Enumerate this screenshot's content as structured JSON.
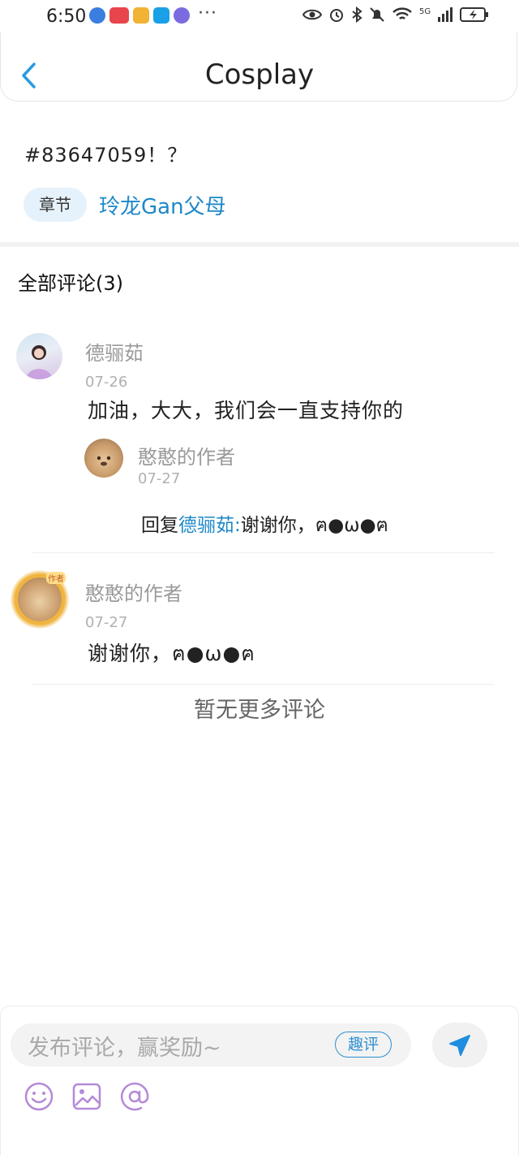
{
  "status_bar": {
    "time": "6:50",
    "more": "···",
    "network": "5G"
  },
  "header": {
    "title": "Cosplay"
  },
  "post": {
    "title": "#83647059！？",
    "chapter_label": "章节",
    "chapter_name": "玲龙Gan父母"
  },
  "comments_section": {
    "title": "全部评论(3)",
    "comments": [
      {
        "username": "德骊茹",
        "date": "07-26",
        "text": "加油，大大，我们会一直支持你的",
        "reply": {
          "username": "憨憨的作者",
          "date": "07-27",
          "prefix": "回复",
          "target": "德骊茹:",
          "text": "谢谢你，ฅ●ω●ฅ"
        }
      },
      {
        "username": "憨憨的作者",
        "author_badge": "作者",
        "date": "07-27",
        "text": "谢谢你，ฅ●ω●ฅ"
      }
    ],
    "no_more": "暂无更多评论"
  },
  "bottom_bar": {
    "placeholder": "发布评论，赢奖励~",
    "fun_label": "趣评",
    "icons": [
      "emoji-icon",
      "image-icon",
      "at-icon",
      "send-icon"
    ]
  },
  "colors": {
    "accent": "#1e88c8",
    "chip_bg": "#e6f2fb",
    "toolbar_icon": "#b48ad8"
  }
}
